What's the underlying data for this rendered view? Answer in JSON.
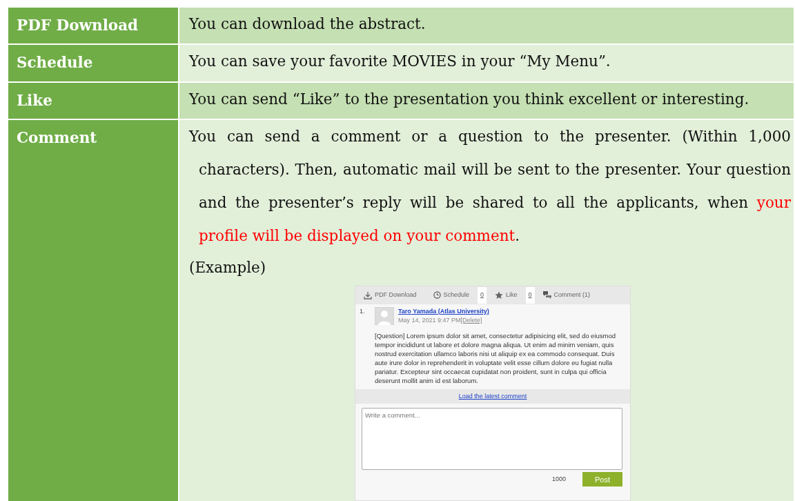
{
  "rows": [
    {
      "feature": "PDF Download",
      "description": [
        {
          "kind": "plain",
          "text": "You can download the abstract."
        }
      ]
    },
    {
      "feature": "Schedule",
      "description": [
        {
          "kind": "plain",
          "text": "You can save your favorite MOVIES in your “My Menu”."
        }
      ]
    },
    {
      "feature": "Like",
      "description": [
        {
          "kind": "plain",
          "text": "You can send “Like” to the presentation you think excellent or interesting."
        }
      ]
    },
    {
      "feature": "Comment",
      "description": [
        {
          "kind": "plain",
          "text": "You can send a comment or a question to the presenter. (Within 1,000 characters). Then, automatic mail will be sent to the presenter. Your question and the presenter’s reply will be shared to all the applicants, when "
        },
        {
          "kind": "highlight",
          "text": "your profile will be displayed on your comment"
        },
        {
          "kind": "plain",
          "text": "."
        }
      ],
      "example_label": "(Example)",
      "example": {
        "tabs": [
          {
            "kind": "download",
            "label": "PDF Download"
          },
          {
            "kind": "schedule",
            "label": "Schedule",
            "count": "0"
          },
          {
            "kind": "like",
            "label": "Like",
            "count": "0"
          },
          {
            "kind": "comment",
            "label": "Comment (1)"
          }
        ],
        "comments": [
          {
            "number": "1.",
            "author": "Taro Yamada (Atlas University)",
            "date": "May 14, 2021 9:47 PM",
            "delete_link": "[Delete]",
            "body": "[Question] Lorem ipsum dolor sit amet, consectetur adipisicing elit, sed do eiusmod tempor incididunt ut labore et dolore magna aliqua. Ut enim ad minim veniam, quis nostrud exercitation ullamco laboris nisi ut aliquip ex ea commodo consequat. Duis aute irure dolor in reprehenderit in voluptate velit esse cillum dolore eu fugiat nulla pariatur. Excepteur sint occaecat cupidatat non proident, sunt in culpa qui officia deserunt mollit anim id est laborum."
          }
        ],
        "load_link": "Load the latest comment",
        "comment_field": {
          "placeholder": "Write a comment..."
        },
        "char_count": "1000",
        "post_button": "Post"
      }
    }
  ]
}
